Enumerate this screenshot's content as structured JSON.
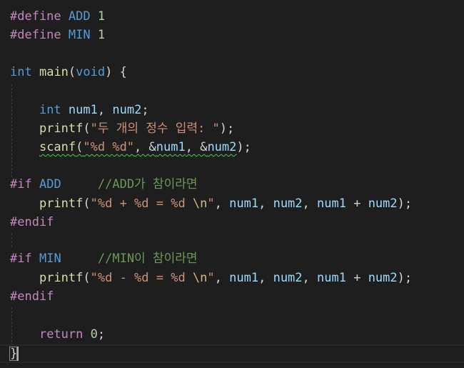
{
  "code": {
    "line1": {
      "directive": "#define",
      "macro": "ADD",
      "value": "1"
    },
    "line2": {
      "directive": "#define",
      "macro": "MIN",
      "value": "1"
    },
    "line4": {
      "type": "int",
      "name": "main",
      "open": "(",
      "param": "void",
      "close": ") {"
    },
    "line6": {
      "type": "int",
      "var1": "num1",
      "sep": ", ",
      "var2": "num2",
      "end": ";"
    },
    "line7": {
      "func": "printf",
      "open": "(",
      "str": "\"두 개의 정수 입력: \"",
      "close": ");"
    },
    "line8": {
      "func": "scanf",
      "open": "(",
      "str": "\"%d %d\"",
      "sep1": ", &",
      "var1": "num1",
      "sep2": ", &",
      "var2": "num2",
      "close": ");"
    },
    "line10": {
      "directive": "#if",
      "macro": "ADD",
      "comment": "//ADD가 참이라면"
    },
    "line11": {
      "func": "printf",
      "open": "(",
      "str_a": "\"%d + %d = %d ",
      "esc": "\\n",
      "str_b": "\"",
      "sep1": ", ",
      "var1": "num1",
      "sep2": ", ",
      "var2": "num2",
      "sep3": ", ",
      "var3": "num1",
      "op": " + ",
      "var4": "num2",
      "close": ");"
    },
    "line12": {
      "directive": "#endif"
    },
    "line14": {
      "directive": "#if",
      "macro": "MIN",
      "comment": "//MIN이 참이라면"
    },
    "line15": {
      "func": "printf",
      "open": "(",
      "str_a": "\"%d - %d = %d ",
      "esc": "\\n",
      "str_b": "\"",
      "sep1": ", ",
      "var1": "num1",
      "sep2": ", ",
      "var2": "num2",
      "sep3": ", ",
      "var3": "num1",
      "op": " + ",
      "var4": "num2",
      "close": ");"
    },
    "line16": {
      "directive": "#endif"
    },
    "line18": {
      "keyword": "return",
      "value": "0",
      "end": ";"
    },
    "line19": {
      "brace": "}"
    }
  }
}
